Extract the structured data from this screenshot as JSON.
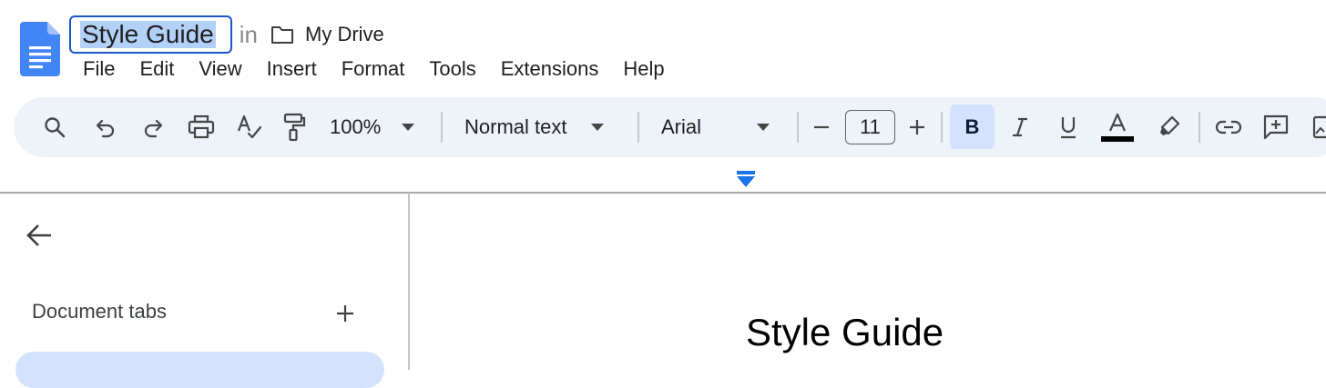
{
  "document": {
    "title": "Style Guide",
    "location_prefix": "in",
    "location": "My Drive",
    "heading": "Style Guide"
  },
  "menu": [
    "File",
    "Edit",
    "View",
    "Insert",
    "Format",
    "Tools",
    "Extensions",
    "Help"
  ],
  "toolbar": {
    "zoom": "100%",
    "style": "Normal text",
    "font": "Arial",
    "font_size": "11",
    "bold_label": "B",
    "bold_active": true,
    "text_color": "#000000",
    "icons": [
      "search-icon",
      "undo-icon",
      "redo-icon",
      "print-icon",
      "spellcheck-icon",
      "paint-format-icon",
      "minus-icon",
      "plus-icon",
      "bold-icon",
      "italic-icon",
      "underline-icon",
      "text-color-icon",
      "highlight-icon",
      "link-icon",
      "add-comment-icon",
      "insert-image-icon"
    ]
  },
  "sidebar": {
    "heading": "Document tabs"
  },
  "colors": {
    "accent": "#1a56c7",
    "selection": "#b3d1f7",
    "toolbar_bg": "#eef2f9",
    "active_bg": "#d3e3fd",
    "docs_blue": "#4285f4"
  }
}
